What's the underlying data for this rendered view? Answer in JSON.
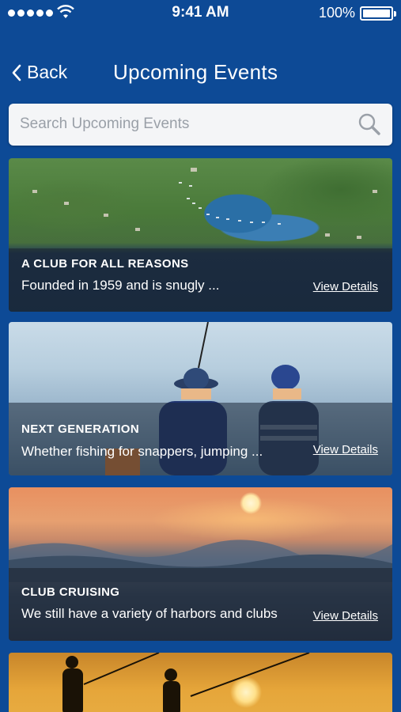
{
  "status_bar": {
    "time": "9:41 AM",
    "battery": "100%",
    "signal_icon": "signal-dots-icon",
    "wifi_icon": "wifi-icon",
    "battery_icon": "battery-icon"
  },
  "nav": {
    "back_label": "Back",
    "title": "Upcoming Events"
  },
  "search": {
    "placeholder": "Search Upcoming Events",
    "value": "",
    "icon": "search-icon"
  },
  "events": [
    {
      "title": "A CLUB FOR ALL REASONS",
      "description": "Founded in 1959 and is snugly ...",
      "details_label": "View Details",
      "image": "aerial-harbor-photo"
    },
    {
      "title": "NEXT GENERATION",
      "description": "Whether fishing for snappers, jumping ...",
      "details_label": "View Details",
      "image": "kids-fishing-photo"
    },
    {
      "title": "CLUB CRUISING",
      "description": "We still have a variety of harbors and clubs",
      "details_label": "View Details",
      "image": "ocean-sunset-photo"
    },
    {
      "title": "",
      "description": "",
      "details_label": "",
      "image": "sunset-fishing-photo"
    }
  ],
  "colors": {
    "background": "#0d4a96",
    "search_bg": "#f4f5f7",
    "overlay": "rgba(20,30,45,0.55)"
  }
}
